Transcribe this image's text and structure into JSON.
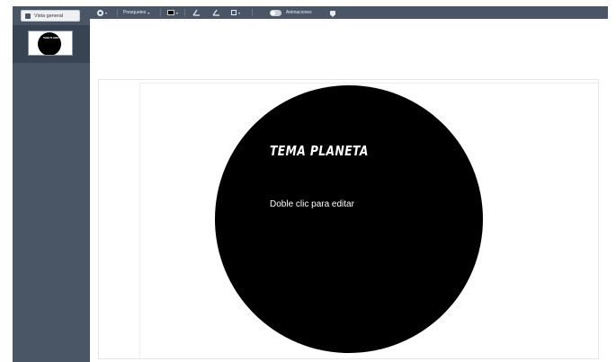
{
  "sidebar": {
    "overview_label": "Vista general",
    "thumbnail_title": "TEMA PLANETA"
  },
  "toolbar": {
    "presets_label": "Presquetes",
    "animations_label": "Animaciones",
    "fill_color": "#000000"
  },
  "slide": {
    "title": "TEMA PLANETA",
    "subtitle": "Doble clic para editar",
    "planet_color": "#000000"
  },
  "colors": {
    "sidebar_bg": "#4a5666",
    "toolbar_bg": "#4a5666",
    "canvas_bg": "#ffffff"
  },
  "icons": {
    "overview": "overview-icon",
    "style": "style-circle-icon",
    "line": "line-angle-icon",
    "shape": "rect-icon",
    "animations_toggle": "toggle-icon",
    "comments": "comment-icon"
  }
}
